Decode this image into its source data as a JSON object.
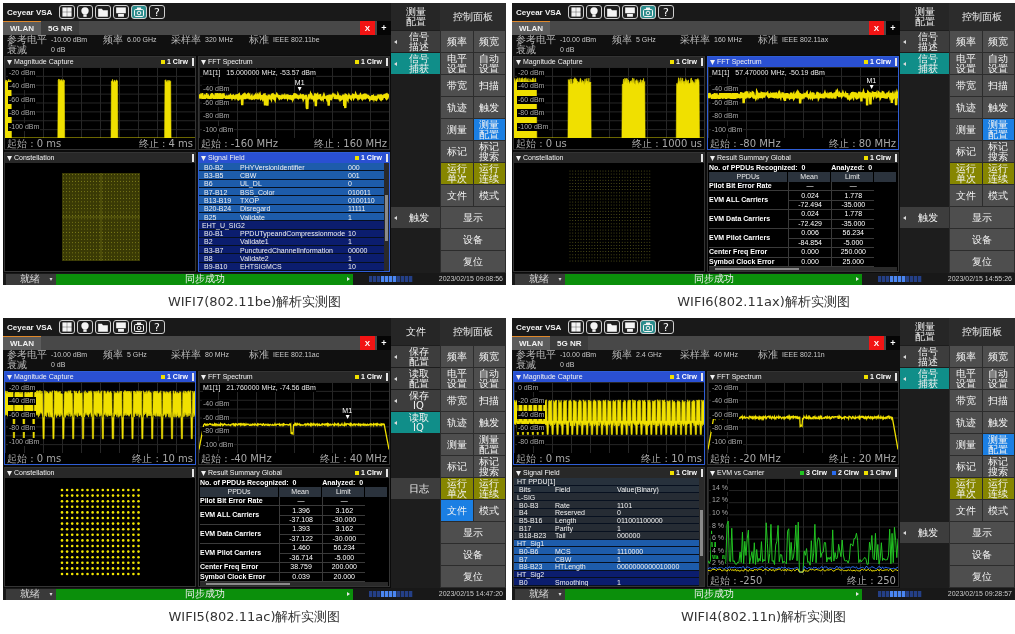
{
  "screens": [
    {
      "app_name": "Ceyear VSA",
      "toolbar_buttons": [
        {
          "on": false
        },
        {
          "on": false
        },
        {
          "on": false
        },
        {
          "on": false
        },
        {
          "on": true
        }
      ],
      "help_label": "?",
      "tabs": [
        {
          "label": "WLAN",
          "selected": true
        },
        {
          "label": "5G NR",
          "selected": false
        }
      ],
      "close_label": "X",
      "add_label": "+",
      "parameters": [
        [
          {
            "label": "参考电平",
            "value": "-10.00 dBm"
          },
          {
            "label": "频率",
            "value": "6.00 GHz"
          },
          {
            "label": "采样率",
            "value": "320 MHz"
          },
          {
            "label": "标准",
            "value": "IEEE 802.11be"
          }
        ],
        [
          {
            "label": "衰减",
            "value": "0 dB"
          }
        ]
      ],
      "panes": [
        {
          "kind": "magnitude",
          "title": "Magnitude Capture",
          "active": false,
          "traces": [
            {
              "label": "1 Clrw",
              "color": "#f0e000"
            }
          ],
          "y_labels": [
            "-20 dBm",
            "-40 dBm",
            "-60 dBm",
            "-80 dBm",
            "-100 dBm"
          ],
          "start": "起始 : 0 ms",
          "stop": "终止 : 4 ms"
        },
        {
          "kind": "spectrum",
          "title": "FFT Spectrum",
          "active": false,
          "traces": [
            {
              "label": "1 Clrw",
              "color": "#f0e000"
            }
          ],
          "marker": {
            "readout": "M1[1]   15.000000 MHz, -53.57 dBm",
            "label": "M1"
          },
          "y_labels": [
            "-40 dBm",
            "-60 dBm",
            "-80 dBm",
            "-100 dBm"
          ],
          "start": "起始 : -160 MHz",
          "stop": "终止 : 160 MHz"
        },
        {
          "kind": "constellation",
          "title": "Constellation",
          "active": false
        },
        {
          "kind": "signal_field",
          "title": "Signal Field",
          "active": true,
          "traces": [
            {
              "label": "1 Clrw",
              "color": "#f0e000"
            }
          ],
          "rows": [
            {
              "kind": "field",
              "bits": "B0-B2",
              "field": "PHYVersionIdentifier",
              "value": "000",
              "color": "#1d5cab"
            },
            {
              "kind": "field",
              "bits": "B3-B5",
              "field": "CBW",
              "value": "001",
              "color": "#1d5cab"
            },
            {
              "kind": "field",
              "bits": "B6",
              "field": "UL_DL",
              "value": "0",
              "color": "#1d5cab"
            },
            {
              "kind": "field",
              "bits": "B7-B12",
              "field": "BSS_Color",
              "value": "010011",
              "color": "#1d5cab"
            },
            {
              "kind": "field",
              "bits": "B13-B19",
              "field": "TXOP",
              "value": "0100110",
              "color": "#1d5cab"
            },
            {
              "kind": "field",
              "bits": "B20-B24",
              "field": "Disregard",
              "value": "11111",
              "color": "#1d5cab"
            },
            {
              "kind": "field",
              "bits": "B25",
              "field": "Validate",
              "value": "1",
              "color": "#1d5cab"
            },
            {
              "kind": "group",
              "label": "EHT_U_SIG2",
              "color": "#0b1d6e"
            },
            {
              "kind": "field",
              "bits": "B0-B1",
              "field": "PPDUTypeandCompressionmode",
              "value": "10",
              "color": "#0b1d6e"
            },
            {
              "kind": "field",
              "bits": "B2",
              "field": "Validate1",
              "value": "1",
              "color": "#0b1d6e"
            },
            {
              "kind": "field",
              "bits": "B3-B7",
              "field": "PuncturedChannelInformation",
              "value": "00000",
              "color": "#0b1d6e"
            },
            {
              "kind": "field",
              "bits": "B8",
              "field": "Validate2",
              "value": "1",
              "color": "#0b1d6e"
            },
            {
              "kind": "field",
              "bits": "B9-B10",
              "field": "EHTSIGMCS",
              "value": "10",
              "color": "#0b1d6e"
            }
          ]
        }
      ],
      "softkeys": {
        "title": "测量配置",
        "items": [
          {
            "kind": "key",
            "label": "信号描述",
            "arrow": true,
            "selected": false
          },
          {
            "kind": "key",
            "label": "信号捕获",
            "arrow": true,
            "selected": true
          },
          {
            "kind": "blank"
          },
          {
            "kind": "blank"
          },
          {
            "kind": "blank"
          },
          {
            "kind": "blank"
          },
          {
            "kind": "blank"
          },
          {
            "kind": "blank"
          },
          {
            "kind": "key",
            "label": "触发",
            "arrow": true,
            "selected": false
          }
        ]
      },
      "control_panel": {
        "title": "控制面板",
        "rows": [
          [
            {
              "label": "频率",
              "kind": "normal",
              "selected": false
            },
            {
              "label": "频宽",
              "kind": "normal",
              "selected": false
            }
          ],
          [
            {
              "label": "电平设置",
              "kind": "normal",
              "selected": false
            },
            {
              "label": "自动设置",
              "kind": "normal",
              "selected": false
            }
          ],
          [
            {
              "label": "带宽",
              "kind": "normal",
              "selected": false
            },
            {
              "label": "扫描",
              "kind": "normal",
              "selected": false
            }
          ],
          [
            {
              "label": "轨迹",
              "kind": "normal",
              "selected": false
            },
            {
              "label": "触发",
              "kind": "normal",
              "selected": false
            }
          ],
          [
            {
              "label": "测量",
              "kind": "normal",
              "selected": false
            },
            {
              "label": "测量配置",
              "kind": "normal",
              "selected": true
            }
          ],
          [
            {
              "label": "标记",
              "kind": "normal",
              "selected": false
            },
            {
              "label": "标记搜索",
              "kind": "normal",
              "selected": false
            }
          ],
          [
            {
              "label": "运行单次",
              "kind": "run",
              "selected": false
            },
            {
              "label": "运行连续",
              "kind": "run",
              "selected": false
            }
          ],
          [
            {
              "label": "文件",
              "kind": "normal",
              "selected": false
            },
            {
              "label": "模式",
              "kind": "normal",
              "selected": false
            }
          ],
          [
            {
              "label": "显示",
              "kind": "normal",
              "selected": false
            }
          ],
          [
            {
              "label": "设备",
              "kind": "normal",
              "selected": false
            }
          ],
          [
            {
              "label": "复位",
              "kind": "normal",
              "selected": false
            }
          ]
        ]
      },
      "status_bar": {
        "mode": "就绪",
        "message": "同步成功",
        "time": "2023/02/15 09:08:56"
      },
      "caption": "WIFI7(802.11be)解析实测图"
    },
    {
      "app_name": "Ceyear VSA",
      "toolbar_buttons": [
        {
          "on": false
        },
        {
          "on": false
        },
        {
          "on": false
        },
        {
          "on": false
        },
        {
          "on": true
        }
      ],
      "help_label": "?",
      "tabs": [
        {
          "label": "WLAN",
          "selected": true
        }
      ],
      "close_label": "X",
      "add_label": "+",
      "parameters": [
        [
          {
            "label": "参考电平",
            "value": "-10.00 dBm"
          },
          {
            "label": "频率",
            "value": "5 GHz"
          },
          {
            "label": "采样率",
            "value": "160 MHz"
          },
          {
            "label": "标准",
            "value": "IEEE 802.11ax"
          }
        ],
        [
          {
            "label": "衰减",
            "value": "0 dB"
          }
        ]
      ],
      "panes": [
        {
          "kind": "magnitude",
          "title": "Magnitude Capture",
          "active": false,
          "traces": [
            {
              "label": "1 Clrw",
              "color": "#f0e000"
            }
          ],
          "y_labels": [
            "-20 dBm",
            "-40 dBm",
            "-60 dBm",
            "-80 dBm",
            "-100 dBm"
          ],
          "start": "起始 : 0 us",
          "stop": "终止 : 1000 us"
        },
        {
          "kind": "spectrum",
          "title": "FFT Spectrum",
          "active": true,
          "traces": [
            {
              "label": "1 Clrw",
              "color": "#f0e000"
            }
          ],
          "marker": {
            "readout": "M1[1]   57.470000 MHz, -50.19 dBm",
            "label": "M1"
          },
          "y_labels": [
            "-40 dBm",
            "-60 dBm",
            "-80 dBm",
            "-100 dBm"
          ],
          "start": "起始 : -80 MHz",
          "stop": "终止 : 80 MHz"
        },
        {
          "kind": "constellation",
          "title": "Constellation",
          "active": false
        },
        {
          "kind": "summary",
          "title": "Result Summary Global",
          "active": false,
          "traces": [
            {
              "label": "1 Clrw",
              "color": "#f0e000"
            }
          ],
          "recognized": "No. of PPDUs Recognized:  0",
          "analyzed": "Analyzed:  0",
          "columns": [
            "PPDUs",
            "Mean",
            "Limit"
          ],
          "rows": [
            {
              "label": "Pilot Bit Error Rate",
              "values": [
                [
                  "—",
                  "—"
                ]
              ]
            },
            {
              "label": "EVM ALL Carriers",
              "values": [
                [
                  "0.024",
                  "1.778"
                ],
                [
                  "-72.494",
                  "-35.000"
                ]
              ]
            },
            {
              "label": "EVM Data Carriers",
              "values": [
                [
                  "0.024",
                  "1.778"
                ],
                [
                  "-72.429",
                  "-35.000"
                ]
              ]
            },
            {
              "label": "EVM Pilot Carriers",
              "values": [
                [
                  "0.006",
                  "56.234"
                ],
                [
                  "-84.854",
                  "-5.000"
                ]
              ]
            },
            {
              "label": "Center Freq Error",
              "values": [
                [
                  "0.000",
                  "250.000"
                ]
              ]
            },
            {
              "label": "Symbol Clock Error",
              "values": [
                [
                  "0.000",
                  "25.000"
                ]
              ]
            }
          ]
        }
      ],
      "softkeys": {
        "title": "测量配置",
        "items": [
          {
            "kind": "key",
            "label": "信号描述",
            "arrow": true,
            "selected": false
          },
          {
            "kind": "key",
            "label": "信号捕获",
            "arrow": true,
            "selected": true
          },
          {
            "kind": "blank"
          },
          {
            "kind": "blank"
          },
          {
            "kind": "blank"
          },
          {
            "kind": "blank"
          },
          {
            "kind": "blank"
          },
          {
            "kind": "blank"
          },
          {
            "kind": "key",
            "label": "触发",
            "arrow": true,
            "selected": false
          }
        ]
      },
      "control_panel": {
        "title": "控制面板",
        "rows": [
          [
            {
              "label": "频率",
              "kind": "normal",
              "selected": false
            },
            {
              "label": "频宽",
              "kind": "normal",
              "selected": false
            }
          ],
          [
            {
              "label": "电平设置",
              "kind": "normal",
              "selected": false
            },
            {
              "label": "自动设置",
              "kind": "normal",
              "selected": false
            }
          ],
          [
            {
              "label": "带宽",
              "kind": "normal",
              "selected": false
            },
            {
              "label": "扫描",
              "kind": "normal",
              "selected": false
            }
          ],
          [
            {
              "label": "轨迹",
              "kind": "normal",
              "selected": false
            },
            {
              "label": "触发",
              "kind": "normal",
              "selected": false
            }
          ],
          [
            {
              "label": "测量",
              "kind": "normal",
              "selected": false
            },
            {
              "label": "测量配置",
              "kind": "normal",
              "selected": true
            }
          ],
          [
            {
              "label": "标记",
              "kind": "normal",
              "selected": false
            },
            {
              "label": "标记搜索",
              "kind": "normal",
              "selected": false
            }
          ],
          [
            {
              "label": "运行单次",
              "kind": "run",
              "selected": false
            },
            {
              "label": "运行连续",
              "kind": "run",
              "selected": false
            }
          ],
          [
            {
              "label": "文件",
              "kind": "normal",
              "selected": false
            },
            {
              "label": "模式",
              "kind": "normal",
              "selected": false
            }
          ],
          [
            {
              "label": "显示",
              "kind": "normal",
              "selected": false
            }
          ],
          [
            {
              "label": "设备",
              "kind": "normal",
              "selected": false
            }
          ],
          [
            {
              "label": "复位",
              "kind": "normal",
              "selected": false
            }
          ]
        ]
      },
      "status_bar": {
        "mode": "就绪",
        "message": "同步成功",
        "time": "2023/02/15 14:55:26"
      },
      "caption": "WIFI6(802.11ax)解析实测图"
    },
    {
      "app_name": "Ceyear VSA",
      "toolbar_buttons": [
        {
          "on": false
        },
        {
          "on": false
        },
        {
          "on": false
        },
        {
          "on": false
        },
        {
          "on": false
        }
      ],
      "help_label": "?",
      "tabs": [
        {
          "label": "WLAN",
          "selected": true
        }
      ],
      "close_label": "X",
      "add_label": "+",
      "parameters": [
        [
          {
            "label": "参考电平",
            "value": "-10.00 dBm"
          },
          {
            "label": "频率",
            "value": "5 GHz"
          },
          {
            "label": "采样率",
            "value": "80 MHz"
          },
          {
            "label": "标准",
            "value": "IEEE 802.11ac"
          }
        ],
        [
          {
            "label": "衰减",
            "value": "0 dB"
          }
        ]
      ],
      "panes": [
        {
          "kind": "magnitude",
          "title": "Magnitude Capture",
          "active": true,
          "traces": [
            {
              "label": "1 Clrw",
              "color": "#f0e000"
            }
          ],
          "y_labels": [
            "-20 dBm",
            "-40 dBm",
            "-60 dBm",
            "-80 dBm",
            "-100 dBm"
          ],
          "start": "起始 : 0 ms",
          "stop": "终止 : 10 ms"
        },
        {
          "kind": "spectrum",
          "title": "FFT Spectrum",
          "active": false,
          "traces": [
            {
              "label": "1 Clrw",
              "color": "#f0e000"
            }
          ],
          "marker": {
            "readout": "M1[1]   21.760000 MHz, -74.56 dBm",
            "label": "M1"
          },
          "y_labels": [
            "-40 dBm",
            "-60 dBm",
            "-80 dBm",
            "-100 dBm"
          ],
          "start": "起始 : -40 MHz",
          "stop": "终止 : 40 MHz"
        },
        {
          "kind": "constellation",
          "title": "Constellation",
          "active": false
        },
        {
          "kind": "summary",
          "title": "Result Summary Global",
          "active": false,
          "traces": [
            {
              "label": "1 Clrw",
              "color": "#f0e000"
            }
          ],
          "recognized": "No. of PPDUs Recognized:  0",
          "analyzed": "Analyzed:  0",
          "columns": [
            "PPDUs",
            "Mean",
            "Limit"
          ],
          "rows": [
            {
              "label": "Pilot Bit Error Rate",
              "values": [
                [
                  "—",
                  "—"
                ]
              ]
            },
            {
              "label": "EVM ALL Carriers",
              "values": [
                [
                  "1.396",
                  "3.162"
                ],
                [
                  "-37.108",
                  "-30.000"
                ]
              ]
            },
            {
              "label": "EVM Data Carriers",
              "values": [
                [
                  "1.393",
                  "3.162"
                ],
                [
                  "-37.122",
                  "-30.000"
                ]
              ]
            },
            {
              "label": "EVM Pilot Carriers",
              "values": [
                [
                  "1.460",
                  "56.234"
                ],
                [
                  "-36.714",
                  "-5.000"
                ]
              ]
            },
            {
              "label": "Center Freq Error",
              "values": [
                [
                  "38.759",
                  "200.000"
                ]
              ]
            },
            {
              "label": "Symbol Clock Error",
              "values": [
                [
                  "0.039",
                  "20.000"
                ]
              ]
            }
          ]
        }
      ],
      "softkeys": {
        "title": "文件",
        "items": [
          {
            "kind": "key",
            "label": "保存配置",
            "arrow": true,
            "selected": false
          },
          {
            "kind": "key",
            "label": "读取配置",
            "arrow": true,
            "selected": false
          },
          {
            "kind": "key",
            "label": "保存IQ",
            "arrow": true,
            "selected": false
          },
          {
            "kind": "key",
            "label": "读取IQ",
            "arrow": true,
            "selected": true
          },
          {
            "kind": "blank"
          },
          {
            "kind": "blank"
          },
          {
            "kind": "key",
            "label": "日志",
            "arrow": false,
            "selected": false
          }
        ]
      },
      "control_panel": {
        "title": "控制面板",
        "rows": [
          [
            {
              "label": "频率",
              "kind": "normal",
              "selected": false
            },
            {
              "label": "频宽",
              "kind": "normal",
              "selected": false
            }
          ],
          [
            {
              "label": "电平设置",
              "kind": "normal",
              "selected": false
            },
            {
              "label": "自动设置",
              "kind": "normal",
              "selected": false
            }
          ],
          [
            {
              "label": "带宽",
              "kind": "normal",
              "selected": false
            },
            {
              "label": "扫描",
              "kind": "normal",
              "selected": false
            }
          ],
          [
            {
              "label": "轨迹",
              "kind": "normal",
              "selected": false
            },
            {
              "label": "触发",
              "kind": "normal",
              "selected": false
            }
          ],
          [
            {
              "label": "测量",
              "kind": "normal",
              "selected": false
            },
            {
              "label": "测量配置",
              "kind": "normal",
              "selected": false
            }
          ],
          [
            {
              "label": "标记",
              "kind": "normal",
              "selected": false
            },
            {
              "label": "标记搜索",
              "kind": "normal",
              "selected": false
            }
          ],
          [
            {
              "label": "运行单次",
              "kind": "run",
              "selected": false
            },
            {
              "label": "运行连续",
              "kind": "run",
              "selected": false
            }
          ],
          [
            {
              "label": "文件",
              "kind": "normal",
              "selected": true
            },
            {
              "label": "模式",
              "kind": "normal",
              "selected": false
            }
          ],
          [
            {
              "label": "显示",
              "kind": "normal",
              "selected": false
            }
          ],
          [
            {
              "label": "设备",
              "kind": "normal",
              "selected": false
            }
          ],
          [
            {
              "label": "复位",
              "kind": "normal",
              "selected": false
            }
          ]
        ]
      },
      "status_bar": {
        "mode": "就绪",
        "message": "同步成功",
        "time": "2023/02/15 14:47:20"
      },
      "caption": "WIFI5(802.11ac)解析实测图"
    },
    {
      "app_name": "Ceyear VSA",
      "toolbar_buttons": [
        {
          "on": false
        },
        {
          "on": false
        },
        {
          "on": false
        },
        {
          "on": false
        },
        {
          "on": true
        }
      ],
      "help_label": "?",
      "tabs": [
        {
          "label": "WLAN",
          "selected": true
        },
        {
          "label": "5G NR",
          "selected": false
        }
      ],
      "close_label": "X",
      "add_label": "+",
      "parameters": [
        [
          {
            "label": "参考电平",
            "value": "-10.00 dBm"
          },
          {
            "label": "频率",
            "value": "2.4 GHz"
          },
          {
            "label": "采样率",
            "value": "40 MHz"
          },
          {
            "label": "标准",
            "value": "IEEE 802.11n"
          }
        ],
        [
          {
            "label": "衰减",
            "value": "0 dB"
          }
        ]
      ],
      "panes": [
        {
          "kind": "magnitude",
          "title": "Magnitude Capture",
          "active": true,
          "traces": [
            {
              "label": "1 Clrw",
              "color": "#f0e000"
            }
          ],
          "y_labels": [
            "0 dBm",
            "-20 dBm",
            "-40 dBm",
            "-60 dBm",
            "-80 dBm"
          ],
          "start": "起始 : 0 ms",
          "stop": "终止 : 10 ms"
        },
        {
          "kind": "spectrum",
          "title": "FFT Spectrum",
          "active": false,
          "traces": [
            {
              "label": "1 Clrw",
              "color": "#f0e000"
            }
          ],
          "y_labels": [
            "-20 dBm",
            "-40 dBm",
            "-60 dBm",
            "-80 dBm",
            "-100 dBm"
          ],
          "start": "起始 : -20 MHz",
          "stop": "终止 : 20 MHz"
        },
        {
          "kind": "signal_field",
          "title": "Signal Field",
          "active": false,
          "traces": [
            {
              "label": "1 Clrw",
              "color": "#f0e000"
            }
          ],
          "table_title": "HT PPDU[1]",
          "columns": [
            "Bits",
            "Field",
            "Value(Binary)"
          ],
          "rows": [
            {
              "kind": "group",
              "label": "L-SIG",
              "color": "#262c34"
            },
            {
              "kind": "field",
              "bits": "B0-B3",
              "field": "Rate",
              "value": "1101",
              "color": "#262c34"
            },
            {
              "kind": "field",
              "bits": "B4",
              "field": "Reserved",
              "value": "0",
              "color": "#262c34"
            },
            {
              "kind": "field",
              "bits": "B5-B16",
              "field": "Length",
              "value": "011001100000",
              "color": "#262c34"
            },
            {
              "kind": "field",
              "bits": "B17",
              "field": "Parity",
              "value": "1",
              "color": "#262c34"
            },
            {
              "kind": "field",
              "bits": "B18-B23",
              "field": "Tail",
              "value": "000000",
              "color": "#262c34"
            },
            {
              "kind": "group",
              "label": "HT_Sig1",
              "color": "#1d5cab"
            },
            {
              "kind": "field",
              "bits": "B0-B6",
              "field": "MCS",
              "value": "1110000",
              "color": "#1d5cab"
            },
            {
              "kind": "field",
              "bits": "B7",
              "field": "CBW",
              "value": "1",
              "color": "#1d5cab"
            },
            {
              "kind": "field",
              "bits": "B8-B23",
              "field": "HTLength",
              "value": "0000000000010000",
              "color": "#1d5cab"
            },
            {
              "kind": "group",
              "label": "HT_Sig2",
              "color": "#0b1d6e"
            },
            {
              "kind": "field",
              "bits": "B0",
              "field": "Smoothing",
              "value": "1",
              "color": "#0b1d6e"
            }
          ]
        },
        {
          "kind": "evm",
          "title": "EVM vs Carrier",
          "active": false,
          "traces": [
            {
              "label": "3 Clrw",
              "color": "#22c422"
            },
            {
              "label": "2 Clrw",
              "color": "#2a6cf0"
            },
            {
              "label": "1 Clrw",
              "color": "#f0e000"
            }
          ],
          "y_labels": [
            "14 %",
            "12 %",
            "10 %",
            "8 %",
            "6 %",
            "4 %",
            "2 %"
          ],
          "start": "起始 : -250",
          "stop": "终止 : 250"
        }
      ],
      "softkeys": {
        "title": "测量配置",
        "items": [
          {
            "kind": "key",
            "label": "信号描述",
            "arrow": true,
            "selected": false
          },
          {
            "kind": "key",
            "label": "信号捕获",
            "arrow": true,
            "selected": true
          },
          {
            "kind": "blank"
          },
          {
            "kind": "blank"
          },
          {
            "kind": "blank"
          },
          {
            "kind": "blank"
          },
          {
            "kind": "blank"
          },
          {
            "kind": "blank"
          },
          {
            "kind": "key",
            "label": "触发",
            "arrow": true,
            "selected": false
          }
        ]
      },
      "control_panel": {
        "title": "控制面板",
        "rows": [
          [
            {
              "label": "频率",
              "kind": "normal",
              "selected": false
            },
            {
              "label": "频宽",
              "kind": "normal",
              "selected": false
            }
          ],
          [
            {
              "label": "电平设置",
              "kind": "normal",
              "selected": false
            },
            {
              "label": "自动设置",
              "kind": "normal",
              "selected": false
            }
          ],
          [
            {
              "label": "带宽",
              "kind": "normal",
              "selected": false
            },
            {
              "label": "扫描",
              "kind": "normal",
              "selected": false
            }
          ],
          [
            {
              "label": "轨迹",
              "kind": "normal",
              "selected": false
            },
            {
              "label": "触发",
              "kind": "normal",
              "selected": false
            }
          ],
          [
            {
              "label": "测量",
              "kind": "normal",
              "selected": false
            },
            {
              "label": "测量配置",
              "kind": "normal",
              "selected": true
            }
          ],
          [
            {
              "label": "标记",
              "kind": "normal",
              "selected": false
            },
            {
              "label": "标记搜索",
              "kind": "normal",
              "selected": false
            }
          ],
          [
            {
              "label": "运行单次",
              "kind": "run",
              "selected": false
            },
            {
              "label": "运行连续",
              "kind": "run",
              "selected": false
            }
          ],
          [
            {
              "label": "文件",
              "kind": "normal",
              "selected": false
            },
            {
              "label": "模式",
              "kind": "normal",
              "selected": false
            }
          ],
          [
            {
              "label": "显示",
              "kind": "normal",
              "selected": false
            }
          ],
          [
            {
              "label": "设备",
              "kind": "normal",
              "selected": false
            }
          ],
          [
            {
              "label": "复位",
              "kind": "normal",
              "selected": false
            }
          ]
        ]
      },
      "status_bar": {
        "mode": "就绪",
        "message": "同步成功",
        "time": "2023/02/15 09:28:57"
      },
      "caption": "WIFI4(802.11n)解析实测图"
    }
  ]
}
